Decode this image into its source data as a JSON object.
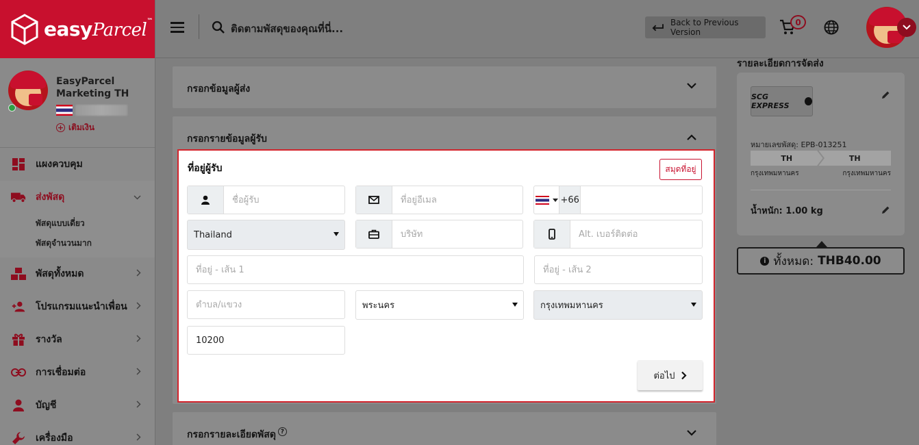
{
  "brand": {
    "logo_main": "easy",
    "logo_script": "Parcel",
    "logo_tm": "™"
  },
  "profile": {
    "name_line1": "EasyParcel",
    "name_line2": "Marketing TH",
    "topup_label": "เติมเงิน"
  },
  "nav": {
    "dashboard": "แผงควบคุม",
    "send_parcel": "ส่งพัสดุ",
    "send_single": "พัสดุแบบเดี่ยว",
    "send_bulk": "พัสดุจำนวนมาก",
    "all_parcels": "พัสดุทั้งหมด",
    "referral": "โปรแกรมแนะนำเพื่อน",
    "rewards": "รางวัล",
    "integrations": "การเชื่อมต่อ",
    "account": "บัญชี",
    "tools": "เครื่องมือ"
  },
  "header": {
    "search_placeholder": "ติดตามพัสดุของคุณที่นี่...",
    "back_label": "Back to Previous Version",
    "cart_count": "0"
  },
  "sections": {
    "sender": "กรอกข้อมูลผู้ส่ง",
    "receiver": "กรอกรายข้อมูลผู้รับ",
    "parcel": "กรอกรายละเอียดพัสดุ"
  },
  "receiver_form": {
    "title": "ที่อยู่ผู้รับ",
    "address_book": "สมุดที่อยู่",
    "name_placeholder": "ชื่อผู้รับ",
    "email_placeholder": "ที่อยู่อีเมล",
    "phone_code": "+66",
    "country": "Thailand",
    "company_placeholder": "บริษัท",
    "alt_phone_placeholder": "Alt. เบอร์ติดต่อ",
    "address1_placeholder": "ที่อยู่ - เส้น 1",
    "address2_placeholder": "ที่อยู่ - เส้น 2",
    "subdistrict_placeholder": "ตำบล/แขวง",
    "district": "พระนคร",
    "province": "กรุงเทพมหานคร",
    "postcode": "10200",
    "next_label": "ต่อไป"
  },
  "shipment": {
    "title": "รายละเอียดการจัดส่ง",
    "courier_name": "SCG EXPRESS",
    "tracking": "หมายเลขพัสดุ: EPB-013251",
    "from_code": "TH",
    "to_code": "TH",
    "from_city": "กรุงเทพมหานคร",
    "to_city": "กรุงเทพมหานคร",
    "weight_label": "น้ำหนัก:",
    "weight_value": "1.00 kg",
    "total_label": "ทั้งหมด:",
    "total_value": "THB40.00"
  },
  "colors": {
    "brand_red": "#c8102e",
    "dark_red": "#8e0d1f"
  }
}
